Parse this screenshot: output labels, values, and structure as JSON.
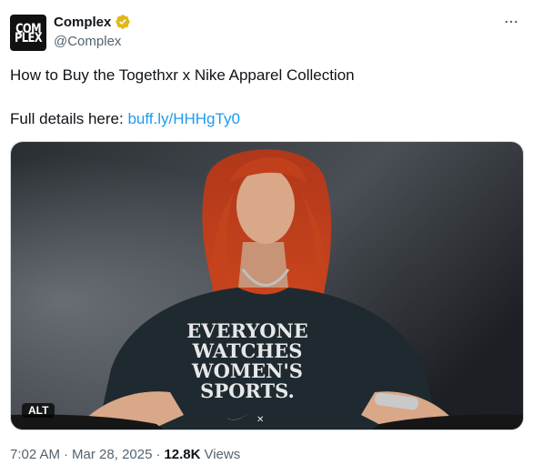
{
  "author": {
    "display_name": "Complex",
    "handle": "@Complex",
    "avatar_text_top": "COM",
    "avatar_text_bottom": "PLEX",
    "verified_color": "#e2b719"
  },
  "more_icon": "more-horizontal-icon",
  "tweet": {
    "text_line1": "How to Buy the Togethxr x Nike Apparel Collection",
    "text_line2_prefix": "Full details here: ",
    "link_text": "buff.ly/HHHgTy0",
    "link_color": "#1d9bf0"
  },
  "media": {
    "shirt_text": [
      "EVERYONE",
      "WATCHES",
      "WOMEN'S",
      "SPORTS."
    ],
    "alt_label": "ALT"
  },
  "footer": {
    "time": "7:02 AM",
    "separator": "·",
    "date": "Mar 28, 2025",
    "views_count": "12.8K",
    "views_label": "Views"
  }
}
